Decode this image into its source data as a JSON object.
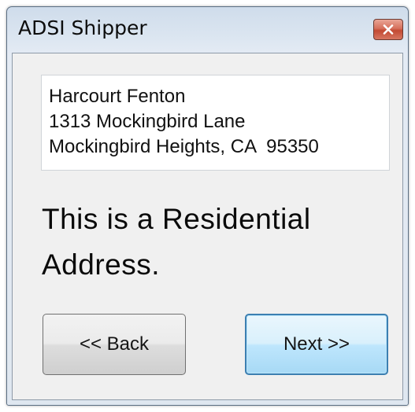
{
  "window": {
    "title": "ADSI Shipper"
  },
  "address": {
    "lines": [
      "Harcourt Fenton",
      "1313 Mockingbird Lane",
      "Mockingbird Heights, CA  95350"
    ]
  },
  "message": "This is a Residential Address.",
  "buttons": {
    "back_label": "<< Back",
    "next_label": "Next >>"
  },
  "colors": {
    "close_button": "#c24a33",
    "next_button_border": "#3c7fb1"
  },
  "icons": {
    "close": "close-icon"
  }
}
